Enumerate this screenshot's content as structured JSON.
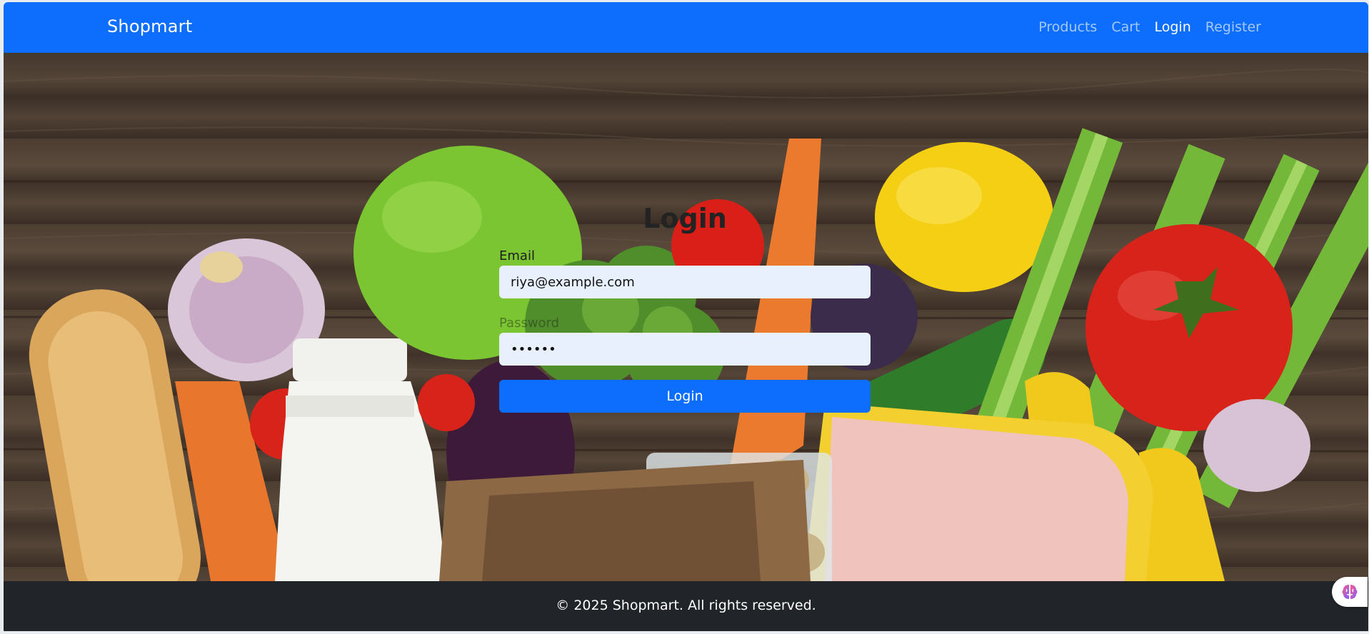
{
  "navbar": {
    "brand": "Shopmart",
    "links": [
      "Products",
      "Cart",
      "Login",
      "Register"
    ],
    "active_link": "Login",
    "bg_color": "#0d6efd"
  },
  "login": {
    "title": "Login",
    "email_label": "Email",
    "email_value": "riya@example.com",
    "password_label": "Password",
    "password_value": "••••••",
    "submit_label": "Login"
  },
  "footer": {
    "text": "© 2025 Shopmart. All rights reserved.",
    "bg_color": "#212529"
  },
  "hero": {
    "background": "grocery-vegetables-photo"
  },
  "extension": {
    "icon": "brain-icon"
  }
}
